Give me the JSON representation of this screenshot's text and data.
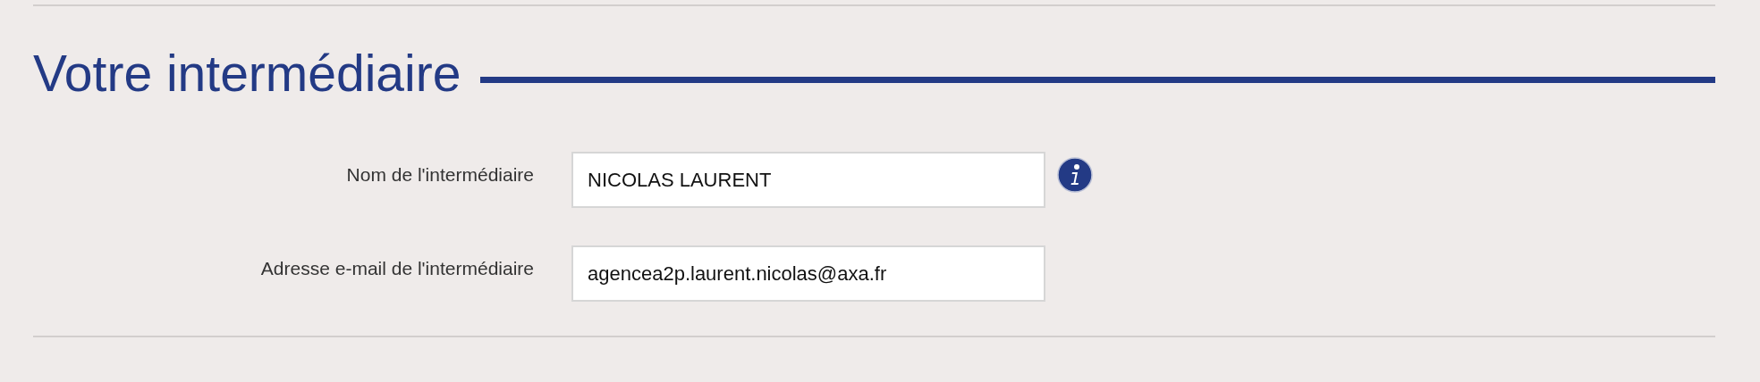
{
  "section": {
    "title": "Votre intermédiaire"
  },
  "fields": [
    {
      "label": "Nom de l'intermédiaire",
      "value": "NICOLAS LAURENT",
      "info": true
    },
    {
      "label": "Adresse e-mail de l'intermédiaire",
      "value": "agencea2p.laurent.nicolas@axa.fr",
      "info": false
    }
  ]
}
